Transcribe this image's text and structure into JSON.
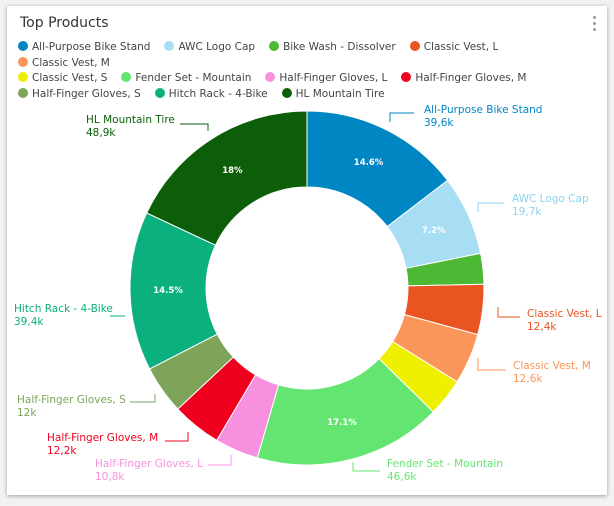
{
  "header": {
    "title": "Top Products"
  },
  "chart_data": {
    "type": "pie",
    "title": "Top Products",
    "donut": true,
    "legend": "top",
    "categories": [
      "All-Purpose Bike Stand",
      "AWC Logo Cap",
      "Bike Wash - Dissolver",
      "Classic Vest, L",
      "Classic Vest, M",
      "Classic Vest, S",
      "Fender Set - Mountain",
      "Half-Finger Gloves, L",
      "Half-Finger Gloves, M",
      "Half-Finger Gloves, S",
      "Hitch Rack - 4-Bike",
      "HL Mountain Tire"
    ],
    "values": [
      39.6,
      19.7,
      7.6,
      12.4,
      12.6,
      9.4,
      46.6,
      10.8,
      12.2,
      12,
      39.4,
      48.9
    ],
    "value_labels": [
      "39,6k",
      "19,7k",
      "",
      "12,4k",
      "12,6k",
      "",
      "46,6k",
      "10,8k",
      "12,2k",
      "12k",
      "39,4k",
      "48,9k"
    ],
    "percent_labels": [
      "14.6%",
      "7.2%",
      "",
      "",
      "",
      "",
      "17.1%",
      "",
      "",
      "",
      "14.5%",
      "18%"
    ],
    "colors": [
      "#0086c3",
      "#a8def4",
      "#4cb833",
      "#ea5421",
      "#fb965a",
      "#eef000",
      "#64e572",
      "#f890e0",
      "#f0001f",
      "#7ea45a",
      "#0bb07f",
      "#0d5e08"
    ]
  }
}
